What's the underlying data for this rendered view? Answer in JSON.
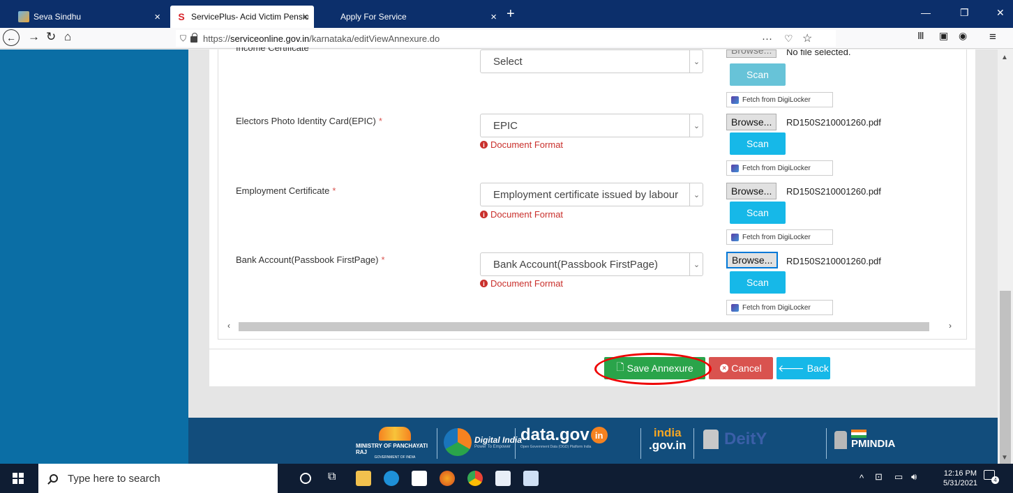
{
  "browser": {
    "tabs": [
      {
        "title": "Seva Sindhu"
      },
      {
        "title": "ServicePlus- Acid Victim Pensio"
      },
      {
        "title": "Apply For Service"
      }
    ],
    "url_prefix": "https://",
    "url_host": "serviceonline.gov.in",
    "url_path": "/karnataka/editViewAnnexure.do"
  },
  "form": {
    "rows": [
      {
        "label": "Income Certificate",
        "required": false,
        "select_value": "Select",
        "browse_label": "Browse...",
        "file_name": "No file selected.",
        "doc_format": "",
        "scan_label": "Scan",
        "fetch_label": "Fetch from DigiLocker"
      },
      {
        "label": "Electors Photo Identity Card(EPIC)",
        "required": true,
        "select_value": "EPIC",
        "browse_label": "Browse...",
        "file_name": "RD150S210001260.pdf",
        "doc_format": "Document Format",
        "scan_label": "Scan",
        "fetch_label": "Fetch from DigiLocker"
      },
      {
        "label": "Employment Certificate",
        "required": true,
        "select_value": "Employment certificate issued by labour",
        "browse_label": "Browse...",
        "file_name": "RD150S210001260.pdf",
        "doc_format": "Document Format",
        "scan_label": "Scan",
        "fetch_label": "Fetch from DigiLocker"
      },
      {
        "label": "Bank Account(Passbook FirstPage)",
        "required": true,
        "select_value": "Bank Account(Passbook FirstPage)",
        "browse_label": "Browse...",
        "file_name": "RD150S210001260.pdf",
        "doc_format": "Document Format",
        "scan_label": "Scan",
        "fetch_label": "Fetch from DigiLocker"
      }
    ],
    "required_mark": "*",
    "actions": {
      "save": "Save Annexure",
      "cancel": "Cancel",
      "back": "Back"
    }
  },
  "footer": {
    "ministry": "MINISTRY OF PANCHAYATI RAJ",
    "ministry_sub": "GOVERNMENT OF INDIA",
    "digital_india": "Digital India",
    "digital_india_sub": "Power To Empower",
    "datagov": "data.gov",
    "datagov_badge": "in",
    "datagov_sub": "Open Government Data (OGD) Platform India",
    "indiagov_top": "india",
    "indiagov_bottom": ".gov.in",
    "deity": "DeitY",
    "pmindia": "PMINDIA"
  },
  "taskbar": {
    "search_placeholder": "Type here to search",
    "time": "12:16 PM",
    "date": "5/31/2021",
    "notification_count": "4"
  },
  "colors": {
    "sidebar": "#0b6ea5",
    "save": "#2aa44a",
    "cancel": "#d9534f",
    "back": "#16b8e8",
    "scan": "#16b8e8",
    "highlight_ring": "#ee0000"
  }
}
